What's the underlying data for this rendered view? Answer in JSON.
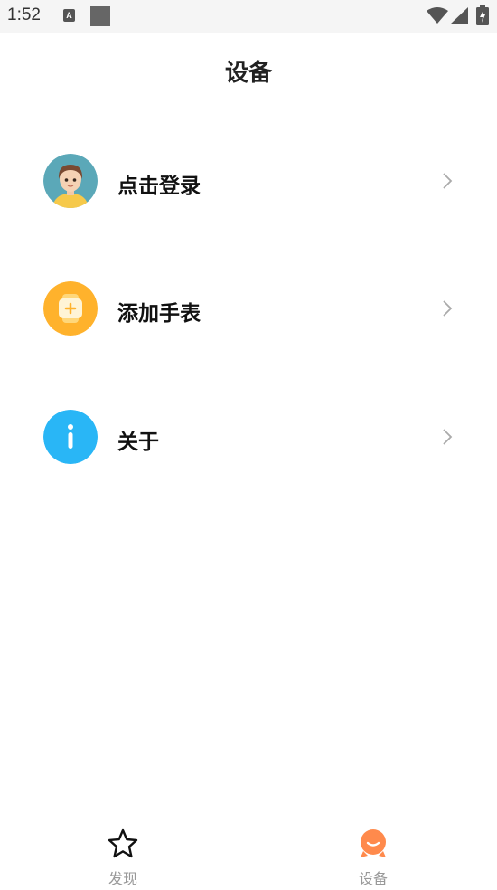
{
  "status_bar": {
    "time": "1:52",
    "notification_letter": "A"
  },
  "header": {
    "title": "设备"
  },
  "menu": {
    "items": [
      {
        "label": "点击登录",
        "icon": "avatar-icon"
      },
      {
        "label": "添加手表",
        "icon": "add-watch-icon"
      },
      {
        "label": "关于",
        "icon": "info-icon"
      }
    ]
  },
  "bottom_nav": {
    "tabs": [
      {
        "label": "发现",
        "icon": "star-icon",
        "active": false
      },
      {
        "label": "设备",
        "icon": "device-icon",
        "active": true
      }
    ]
  },
  "colors": {
    "watch_icon": "#FFB22C",
    "info_icon": "#29B6F6",
    "avatar_bg": "#5BA8B8",
    "device_tab": "#FF8A4C"
  }
}
